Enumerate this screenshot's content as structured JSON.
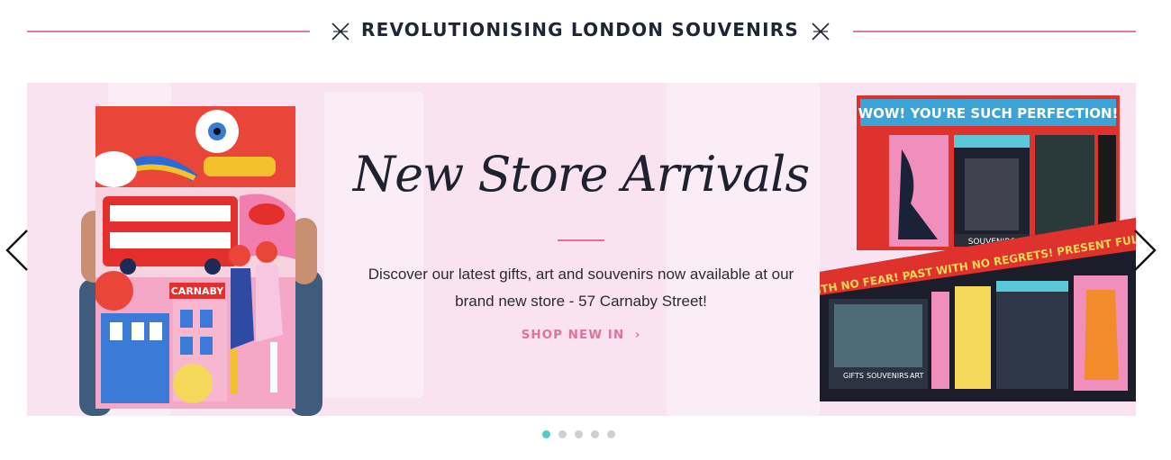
{
  "section": {
    "heading": "REVOLUTIONISING LONDON SOUVENIRS"
  },
  "slide": {
    "title": "New Store Arrivals",
    "description_line1": "Discover our latest gifts, art and souvenirs now available at our",
    "description_line2": "brand new store - 57 Carnaby Street!",
    "cta_label": "SHOP NEW IN",
    "cta_chevron": "›",
    "poster_sign": "CARNABY",
    "store_top_banner": "WOW! YOU'RE SUCH PERFECTION!",
    "store_top_sign": "SOUVENIRS",
    "store_bottom_banner": "FUTURE WITH NO FEAR! PAST WITH NO REGRETS! PRESENT FULL OF LOVE",
    "store_bottom_labels": [
      "GIFTS",
      "SOUVENIRS",
      "ART"
    ]
  },
  "carousel": {
    "prev_icon": "chevron-left-icon",
    "next_icon": "chevron-right-icon",
    "dot_count": 5,
    "active_index": 0
  },
  "colors": {
    "accent_pink": "#e07aa8",
    "banner_bg": "#f9e3f1",
    "dot_active": "#5cc8c3",
    "dot_inactive": "#cfcfcf",
    "heading_text": "#1f2535"
  }
}
